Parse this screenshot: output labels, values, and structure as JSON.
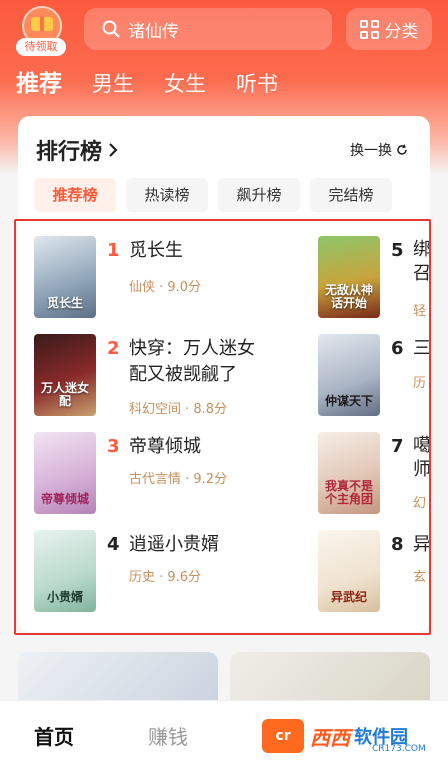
{
  "header": {
    "gift_tag": "待领取",
    "search_placeholder": "诸仙传",
    "category_label": "分类"
  },
  "tabs": [
    {
      "label": "推荐",
      "active": true
    },
    {
      "label": "男生",
      "active": false
    },
    {
      "label": "女生",
      "active": false
    },
    {
      "label": "听书",
      "active": false
    }
  ],
  "ranking": {
    "title": "排行榜",
    "refresh_label": "换一换",
    "subtabs": [
      "推荐榜",
      "热读榜",
      "飙升榜",
      "完结榜"
    ],
    "books": [
      {
        "rank": "1",
        "title": "觅长生",
        "meta": "仙侠 · 9.0分",
        "cover_text": "觅长生"
      },
      {
        "rank": "2",
        "title": "快穿：万人迷女配又被觊觎了",
        "meta": "科幻空间 · 8.8分",
        "cover_text": "万人迷女配"
      },
      {
        "rank": "3",
        "title": "帝尊倾城",
        "meta": "古代言情 · 9.2分",
        "cover_text": "帝尊倾城"
      },
      {
        "rank": "4",
        "title": "逍遥小贵婿",
        "meta": "历史 · 9.6分",
        "cover_text": "小贵婿"
      },
      {
        "rank": "5",
        "title": "绑召",
        "meta": "轻",
        "cover_text": "无敌从神话开始"
      },
      {
        "rank": "6",
        "title": "三",
        "meta": "历",
        "cover_text": "仲谋天下"
      },
      {
        "rank": "7",
        "title": "噶师",
        "meta": "幻",
        "cover_text": "我真不是个主角团"
      },
      {
        "rank": "8",
        "title": "异",
        "meta": "玄",
        "cover_text": "异武纪"
      }
    ]
  },
  "bottom_nav": [
    {
      "label": "首页",
      "active": true
    },
    {
      "label": "赚钱",
      "active": false
    }
  ],
  "watermark": {
    "brand": "西西",
    "brand2": "软件园",
    "sub": "CR173.COM",
    "logo": "cr"
  },
  "colors": {
    "accent": "#ff5a3b",
    "header": "#fb5a3e",
    "meta": "#c8915c",
    "highlight": "#e53935"
  }
}
